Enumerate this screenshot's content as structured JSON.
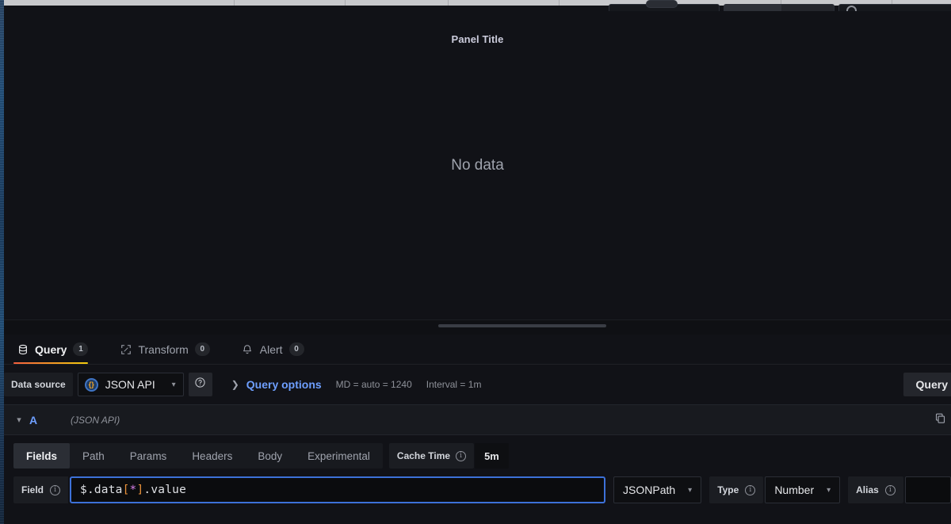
{
  "colors": {
    "accent_orange": "#f55f3e",
    "accent_yellow": "#f2cc0d",
    "link_blue": "#6e9fff",
    "focus_blue": "#3d71d9",
    "bg": "#111217",
    "panel_bg": "#0b0c0e"
  },
  "panel": {
    "title": "Panel Title",
    "no_data_text": "No data"
  },
  "tabs": [
    {
      "label": "Query",
      "count": "1",
      "icon": "database-icon",
      "active": true
    },
    {
      "label": "Transform",
      "count": "0",
      "icon": "transform-icon",
      "active": false
    },
    {
      "label": "Alert",
      "count": "0",
      "icon": "bell-icon",
      "active": false
    }
  ],
  "datasource_row": {
    "label": "Data source",
    "selected": "JSON API",
    "icon": "json-api-icon",
    "help_icon": "help-circle-icon",
    "query_options_label": "Query options",
    "max_data_points": "MD = auto = 1240",
    "interval": "Interval = 1m",
    "query_button": "Query"
  },
  "query": {
    "ref_id": "A",
    "datasource_name": "(JSON API)",
    "collapse_icon": "chevron-down-icon",
    "duplicate_icon": "copy-icon",
    "editor_tabs": [
      {
        "label": "Fields",
        "active": true
      },
      {
        "label": "Path",
        "active": false
      },
      {
        "label": "Params",
        "active": false
      },
      {
        "label": "Headers",
        "active": false
      },
      {
        "label": "Body",
        "active": false
      },
      {
        "label": "Experimental",
        "active": false
      }
    ],
    "cache_time": {
      "label": "Cache Time",
      "value": "5m",
      "info_icon": "info-circle-icon"
    },
    "field_row": {
      "field_label": "Field",
      "field_info_icon": "info-circle-icon",
      "field_value_prefix": "$.data",
      "field_value_open": "[",
      "field_value_star": "*",
      "field_value_close": "]",
      "field_value_suffix": ".value",
      "language_selected": "JSONPath",
      "type_label": "Type",
      "type_info_icon": "info-circle-icon",
      "type_selected": "Number",
      "alias_label": "Alias",
      "alias_info_icon": "info-circle-icon",
      "alias_value": "",
      "alias_placeholder": ""
    }
  }
}
